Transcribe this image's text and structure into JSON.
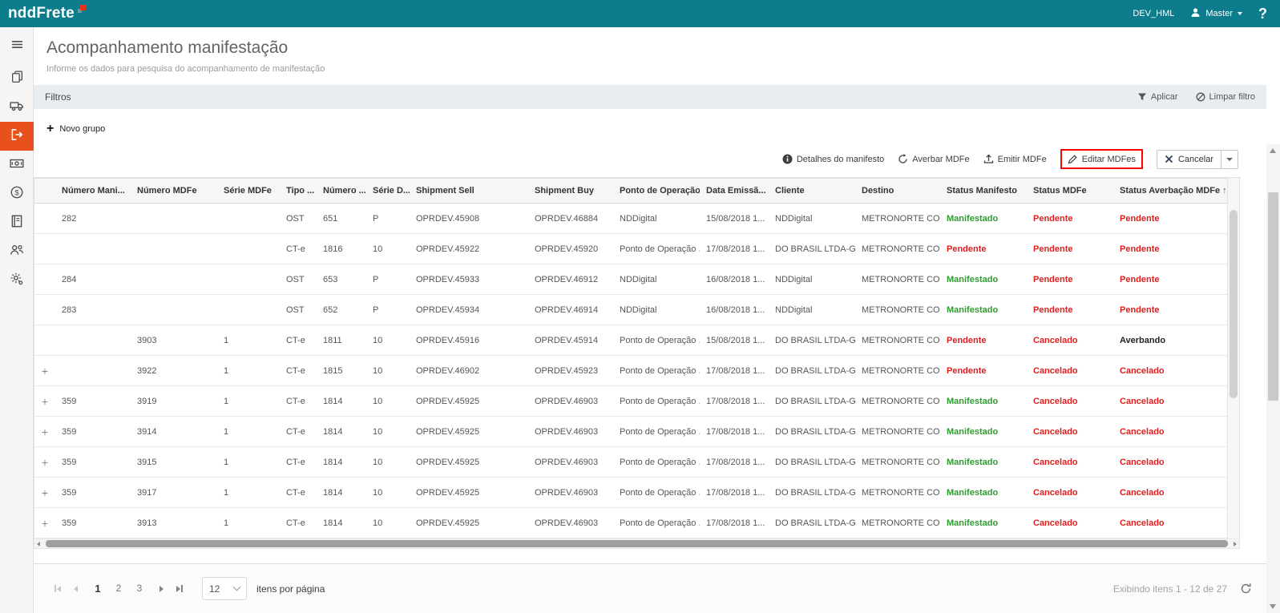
{
  "colors": {
    "topbar_bg": "#0d7c8d",
    "brand_square_red": "#e8341c",
    "sidebar_active_bg": "#e8501e",
    "status_green": "#2f9b2f",
    "status_red": "#e01e1e",
    "status_neutral": "#222222",
    "annotation_red": "#ff0000"
  },
  "topbar": {
    "brand": "nddFrete",
    "environment": "DEV_HML",
    "user_menu": "Master",
    "user_icon": "user-icon",
    "help_label": "?"
  },
  "page": {
    "title": "Acompanhamento manifestação",
    "subtitle": "Informe os dados para pesquisa do acompanhamento de manifestação"
  },
  "sidebar": {
    "items": [
      {
        "icon": "menu-icon",
        "active": false
      },
      {
        "icon": "documents-icon",
        "active": false
      },
      {
        "icon": "truck-icon",
        "active": false
      },
      {
        "icon": "manifest-exit-icon",
        "active": true
      },
      {
        "icon": "banknote-icon",
        "active": false
      },
      {
        "icon": "currency-icon",
        "active": false
      },
      {
        "icon": "ledger-icon",
        "active": false
      },
      {
        "icon": "users-icon",
        "active": false
      },
      {
        "icon": "settings-icon",
        "active": false
      }
    ]
  },
  "filters": {
    "title": "Filtros",
    "apply_label": "Aplicar",
    "apply_icon": "funnel-icon",
    "clear_label": "Limpar filtro",
    "clear_icon": "clear-filter-icon"
  },
  "toolbar": {
    "new_group_label": "Novo grupo",
    "new_group_icon": "plus-icon"
  },
  "actions": [
    {
      "label": "Detalhes do manifesto",
      "icon": "info-icon"
    },
    {
      "label": "Averbar MDFe",
      "icon": "averbar-icon"
    },
    {
      "label": "Emitir MDFe",
      "icon": "emitir-icon"
    },
    {
      "label": "Editar MDFes",
      "icon": "edit-icon",
      "highlighted": true
    },
    {
      "label": "Cancelar",
      "icon": "cancel-icon",
      "button": true,
      "dropdown": true
    }
  ],
  "table": {
    "sort_icon": "↑",
    "columns": [
      {
        "key": "expand",
        "label": ""
      },
      {
        "key": "numero_manifesto",
        "label": "Número Mani..."
      },
      {
        "key": "numero_mdfe",
        "label": "Número MDFe"
      },
      {
        "key": "serie_mdfe",
        "label": "Série MDFe"
      },
      {
        "key": "tipo_documento",
        "label": "Tipo ..."
      },
      {
        "key": "numero_documento",
        "label": "Número ..."
      },
      {
        "key": "serie_documento",
        "label": "Série D..."
      },
      {
        "key": "shipment_sell",
        "label": "Shipment Sell"
      },
      {
        "key": "shipment_buy",
        "label": "Shipment Buy"
      },
      {
        "key": "ponto_operacao",
        "label": "Ponto de Operação"
      },
      {
        "key": "data_emissao",
        "label": "Data Emissã..."
      },
      {
        "key": "cliente",
        "label": "Cliente"
      },
      {
        "key": "destino",
        "label": "Destino"
      },
      {
        "key": "status_manifesto",
        "label": "Status Manifesto"
      },
      {
        "key": "status_mdfe",
        "label": "Status MDFe"
      },
      {
        "key": "status_averbacao_mdfe",
        "label": "Status Averbação MDFe",
        "sorted": "asc"
      }
    ],
    "status_colors": {
      "Manifestado": "#2f9b2f",
      "Pendente": "#e01e1e",
      "Cancelado": "#e01e1e",
      "Averbando": "#222222"
    },
    "rows": [
      [
        "",
        "282",
        "",
        "",
        "OST",
        "651",
        "P",
        "OPRDEV.45908",
        "OPRDEV.46884",
        "NDDigital",
        "15/08/2018 1...",
        "NDDigital",
        "METRONORTE CO...",
        "Manifestado",
        "Pendente",
        "Pendente"
      ],
      [
        "",
        "",
        "",
        "",
        "CT-e",
        "1816",
        "10",
        "OPRDEV.45922",
        "OPRDEV.45920",
        "Ponto de Operação ...",
        "17/08/2018 1...",
        "DO BRASIL LTDA-GU...",
        "METRONORTE CO...",
        "Pendente",
        "Pendente",
        "Pendente"
      ],
      [
        "",
        "284",
        "",
        "",
        "OST",
        "653",
        "P",
        "OPRDEV.45933",
        "OPRDEV.46912",
        "NDDigital",
        "16/08/2018 1...",
        "NDDigital",
        "METRONORTE CO...",
        "Manifestado",
        "Pendente",
        "Pendente"
      ],
      [
        "",
        "283",
        "",
        "",
        "OST",
        "652",
        "P",
        "OPRDEV.45934",
        "OPRDEV.46914",
        "NDDigital",
        "16/08/2018 1...",
        "NDDigital",
        "METRONORTE CO...",
        "Manifestado",
        "Pendente",
        "Pendente"
      ],
      [
        "",
        "",
        "3903",
        "1",
        "CT-e",
        "1811",
        "10",
        "OPRDEV.45916",
        "OPRDEV.45914",
        "Ponto de Operação ...",
        "15/08/2018 1...",
        "DO BRASIL LTDA-GU...",
        "METRONORTE CO...",
        "Pendente",
        "Cancelado",
        "Averbando"
      ],
      [
        "+",
        "",
        "3922",
        "1",
        "CT-e",
        "1815",
        "10",
        "OPRDEV.46902",
        "OPRDEV.45923",
        "Ponto de Operação ...",
        "17/08/2018 1...",
        "DO BRASIL LTDA-GU...",
        "METRONORTE CO...",
        "Pendente",
        "Cancelado",
        "Cancelado"
      ],
      [
        "+",
        "359",
        "3919",
        "1",
        "CT-e",
        "1814",
        "10",
        "OPRDEV.45925",
        "OPRDEV.46903",
        "Ponto de Operação ...",
        "17/08/2018 1...",
        "DO BRASIL LTDA-GU...",
        "METRONORTE CO...",
        "Manifestado",
        "Cancelado",
        "Cancelado"
      ],
      [
        "+",
        "359",
        "3914",
        "1",
        "CT-e",
        "1814",
        "10",
        "OPRDEV.45925",
        "OPRDEV.46903",
        "Ponto de Operação ...",
        "17/08/2018 1...",
        "DO BRASIL LTDA-GU...",
        "METRONORTE CO...",
        "Manifestado",
        "Cancelado",
        "Cancelado"
      ],
      [
        "+",
        "359",
        "3915",
        "1",
        "CT-e",
        "1814",
        "10",
        "OPRDEV.45925",
        "OPRDEV.46903",
        "Ponto de Operação ...",
        "17/08/2018 1...",
        "DO BRASIL LTDA-GU...",
        "METRONORTE CO...",
        "Manifestado",
        "Cancelado",
        "Cancelado"
      ],
      [
        "+",
        "359",
        "3917",
        "1",
        "CT-e",
        "1814",
        "10",
        "OPRDEV.45925",
        "OPRDEV.46903",
        "Ponto de Operação ...",
        "17/08/2018 1...",
        "DO BRASIL LTDA-GU...",
        "METRONORTE CO...",
        "Manifestado",
        "Cancelado",
        "Cancelado"
      ],
      [
        "+",
        "359",
        "3913",
        "1",
        "CT-e",
        "1814",
        "10",
        "OPRDEV.45925",
        "OPRDEV.46903",
        "Ponto de Operação ...",
        "17/08/2018 1...",
        "DO BRASIL LTDA-GU...",
        "METRONORTE CO...",
        "Manifestado",
        "Cancelado",
        "Cancelado"
      ]
    ]
  },
  "pagination": {
    "pages": [
      "1",
      "2",
      "3"
    ],
    "active_page": "1",
    "page_size": "12",
    "page_size_label": "itens por página",
    "summary": "Exibindo itens 1 - 12 de 27",
    "refresh_icon": "refresh-icon"
  }
}
